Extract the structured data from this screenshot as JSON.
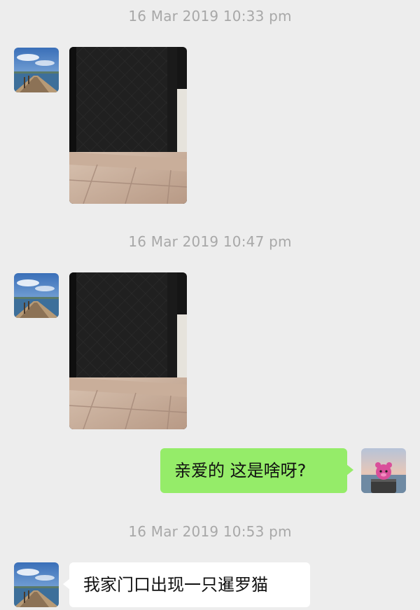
{
  "timestamps": [
    "16 Mar 2019 10:33 pm",
    "16 Mar 2019 10:47 pm",
    "16 Mar 2019 10:53 pm"
  ],
  "messages": {
    "outgoing_text": "亲爱的 这是啥呀?",
    "incoming_text": "我家门口出现一只暹罗猫"
  },
  "images": {
    "contact_avatar": "pier-photo-avatar",
    "self_avatar": "pink-toy-avatar",
    "photo_1": "door-photo",
    "photo_2": "door-photo"
  },
  "colors": {
    "background": "#ededed",
    "outgoing_bubble": "#95ec69",
    "incoming_bubble": "#ffffff",
    "timestamp": "#a8a8a8"
  }
}
